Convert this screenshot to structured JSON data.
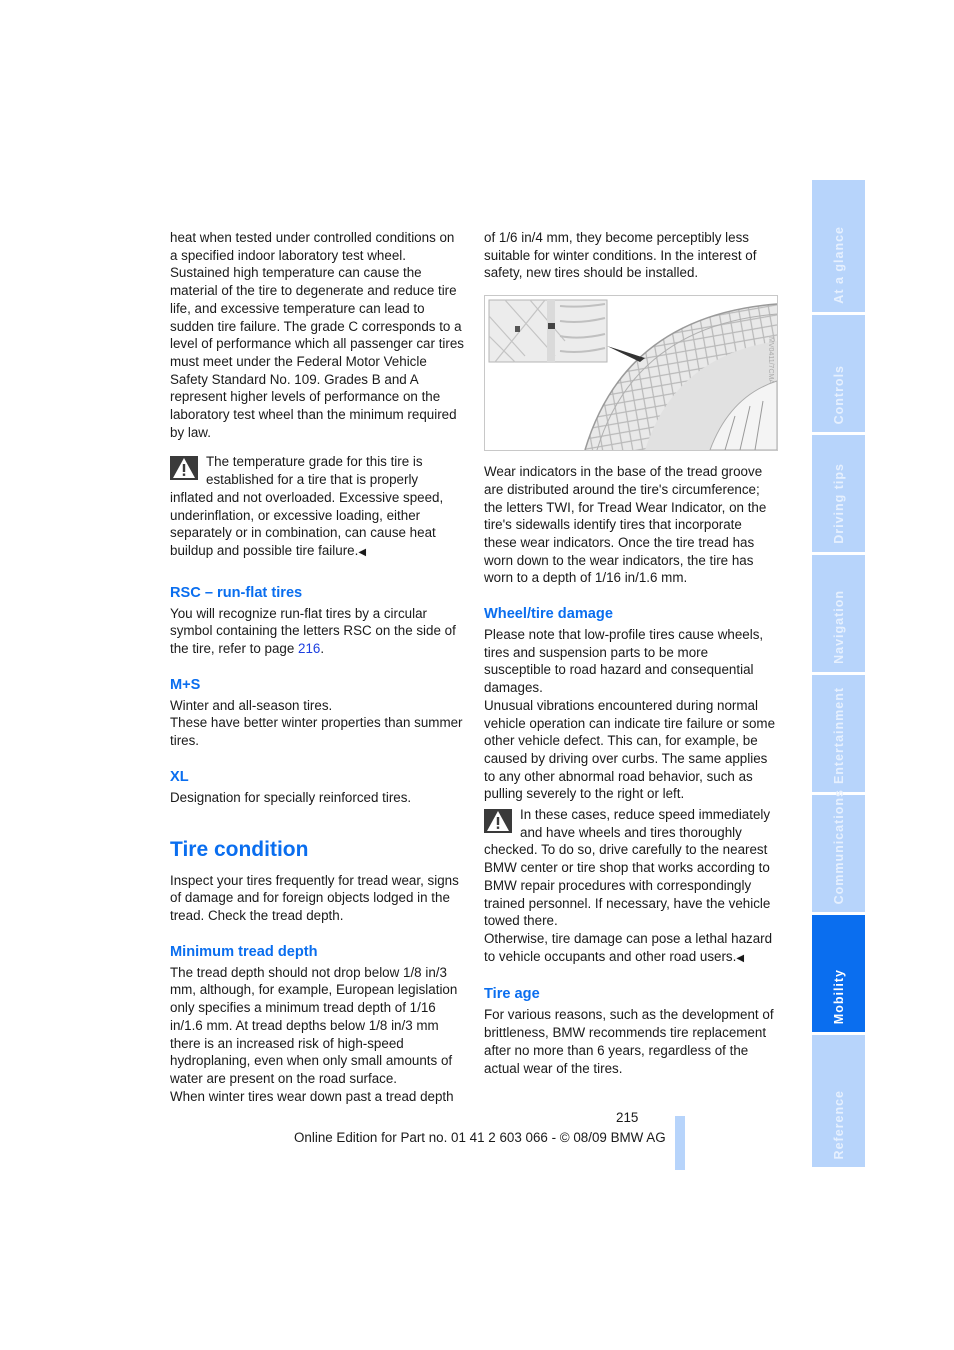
{
  "page": {
    "left_column": {
      "intro_paragraph": "heat when tested under controlled conditions on a specified indoor laboratory test wheel. Sustained high temperature can cause the material of the tire to degenerate and reduce tire life, and excessive temperature can lead to sudden tire failure. The grade C corresponds to a level of performance which all passenger car tires must meet under the Federal Motor Vehicle Safety Standard No. 109. Grades B and A represent higher levels of performance on the laboratory test wheel than the minimum required by law.",
      "warning_1": "The temperature grade for this tire is established for a tire that is properly inflated and not overloaded. Excessive speed, underinflation, or excessive loading, either separately or in combination, can cause heat buildup and possible tire failure.",
      "rsc": {
        "heading": "RSC – run-flat tires",
        "text_before_link": "You will recognize run-flat tires by a circular symbol containing the letters RSC on the side of the tire, refer to page ",
        "link": "216",
        "text_after_link": "."
      },
      "ms": {
        "heading": "M+S",
        "line_1": "Winter and all-season tires.",
        "line_2": "These have better winter properties than summer tires."
      },
      "xl": {
        "heading": "XL",
        "text": "Designation for specially reinforced tires."
      },
      "tire_condition": {
        "heading": "Tire condition",
        "text": "Inspect your tires frequently for tread wear, signs of damage and for foreign objects lodged in the tread. Check the tread depth."
      },
      "min_tread": {
        "heading": "Minimum tread depth",
        "text_1": "The tread depth should not drop below 1/8 in/3 mm, although, for example, European legislation only specifies a minimum tread depth of 1/16 in/1.6 mm. At tread depths below 1/8 in/3 mm there is an increased risk of high-speed hydroplaning, even when only small amounts of water are present on the road surface.",
        "text_2_start": "When winter tires wear down past a tread depth"
      }
    },
    "right_column": {
      "continuation": "of 1/6 in/4 mm, they become perceptibly less suitable for winter conditions. In the interest of safety, new tires should be installed.",
      "figure_code": "MV0411/7CMA",
      "wear_indicators": "Wear indicators in the base of the tread groove are distributed around the tire's circumference; the letters TWI, for Tread Wear Indicator, on the tire's sidewalls identify tires that incorporate these wear indicators. Once the tire tread has worn down to the wear indicators, the tire has worn to a depth of 1/16 in/1.6 mm.",
      "damage": {
        "heading": "Wheel/tire damage",
        "text_1": "Please note that low-profile tires cause wheels, tires and suspension parts to be more susceptible to road hazard and consequential damages.",
        "text_2": "Unusual vibrations encountered during normal vehicle operation can indicate tire failure or some other vehicle defect. This can, for example, be caused by driving over curbs. The same applies to any other abnormal road behavior, such as pulling severely to the right or left.",
        "warning": "In these cases, reduce speed immediately and have wheels and tires thoroughly checked. To do so, drive carefully to the nearest BMW center or tire shop that works according to BMW repair procedures with correspondingly trained personnel. If necessary, have the vehicle towed there.",
        "warning_2": "Otherwise, tire damage can pose a lethal hazard to vehicle occupants and other road users."
      },
      "tire_age": {
        "heading": "Tire age",
        "text": "For various reasons, such as the development of brittleness, BMW recommends tire replacement after no more than 6 years, regardless of the actual wear of the tires."
      }
    },
    "end_mark": "◀",
    "footer": {
      "page_number": "215",
      "edition": "Online Edition for Part no. 01 41 2 603 066 - © 08/09 BMW AG"
    }
  },
  "side_tabs": [
    {
      "label": "At a glance",
      "active": false
    },
    {
      "label": "Controls",
      "active": false
    },
    {
      "label": "Driving tips",
      "active": false
    },
    {
      "label": "Navigation",
      "active": false
    },
    {
      "label": "Entertainment",
      "active": false
    },
    {
      "label": "Communications",
      "active": false
    },
    {
      "label": "Mobility",
      "active": true
    },
    {
      "label": "Reference",
      "active": false
    }
  ],
  "colors": {
    "heading_blue": "#0a6eef",
    "tab_inactive": "#b7d4fb",
    "tab_active": "#0a6eef",
    "link": "#1c3fe0"
  }
}
